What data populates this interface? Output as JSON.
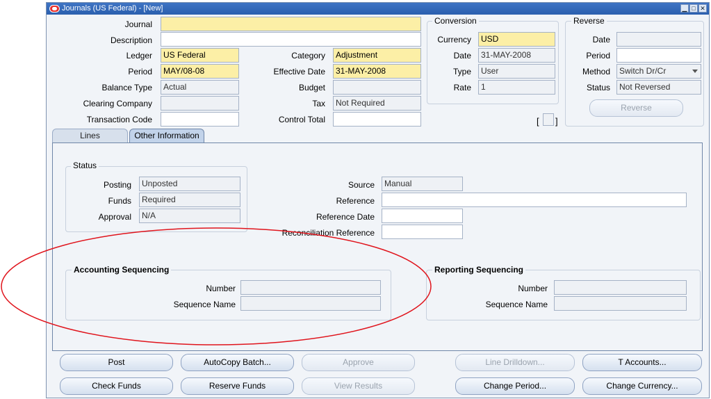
{
  "window": {
    "title": "Journals (US Federal) - [New]"
  },
  "header": {
    "journal_label": "Journal",
    "journal_value": "",
    "description_label": "Description",
    "description_value": "",
    "ledger_label": "Ledger",
    "ledger_value": "US Federal",
    "period_label": "Period",
    "period_value": "MAY/08-08",
    "balance_type_label": "Balance Type",
    "balance_type_value": "Actual",
    "clearing_company_label": "Clearing Company",
    "clearing_company_value": "",
    "transaction_code_label": "Transaction Code",
    "transaction_code_value": "",
    "category_label": "Category",
    "category_value": "Adjustment",
    "effective_date_label": "Effective Date",
    "effective_date_value": "31-MAY-2008",
    "budget_label": "Budget",
    "budget_value": "",
    "tax_label": "Tax",
    "tax_value": "Not Required",
    "control_total_label": "Control Total",
    "control_total_value": ""
  },
  "conversion": {
    "title": "Conversion",
    "currency_label": "Currency",
    "currency_value": "USD",
    "date_label": "Date",
    "date_value": "31-MAY-2008",
    "type_label": "Type",
    "type_value": "User",
    "rate_label": "Rate",
    "rate_value": "1"
  },
  "reverse": {
    "title": "Reverse",
    "date_label": "Date",
    "date_value": "",
    "period_label": "Period",
    "period_value": "",
    "method_label": "Method",
    "method_value": "Switch Dr/Cr",
    "status_label": "Status",
    "status_value": "Not Reversed",
    "reverse_button": "Reverse"
  },
  "tabs": {
    "lines": "Lines",
    "other_information": "Other Information"
  },
  "status_group": {
    "title": "Status",
    "posting_label": "Posting",
    "posting_value": "Unposted",
    "funds_label": "Funds",
    "funds_value": "Required",
    "approval_label": "Approval",
    "approval_value": "N/A"
  },
  "source_group": {
    "source_label": "Source",
    "source_value": "Manual",
    "reference_label": "Reference",
    "reference_value": "",
    "reference_date_label": "Reference Date",
    "reference_date_value": "",
    "reconciliation_reference_label": "Reconciliation Reference",
    "reconciliation_reference_value": ""
  },
  "accounting_sequencing": {
    "title": "Accounting Sequencing",
    "number_label": "Number",
    "number_value": "",
    "sequence_name_label": "Sequence Name",
    "sequence_name_value": ""
  },
  "reporting_sequencing": {
    "title": "Reporting Sequencing",
    "number_label": "Number",
    "number_value": "",
    "sequence_name_label": "Sequence Name",
    "sequence_name_value": ""
  },
  "buttons": {
    "post": "Post",
    "autocopy_batch": "AutoCopy Batch...",
    "approve": "Approve",
    "line_drilldown": "Line Drilldown...",
    "t_accounts": "T Accounts...",
    "check_funds": "Check Funds",
    "reserve_funds": "Reserve Funds",
    "view_results": "View Results",
    "change_period": "Change Period...",
    "change_currency": "Change Currency..."
  },
  "annotation": {
    "color": "#e0141c"
  },
  "colors": {
    "required_field": "#fcefa6",
    "title_bar": "#2a5fae"
  }
}
